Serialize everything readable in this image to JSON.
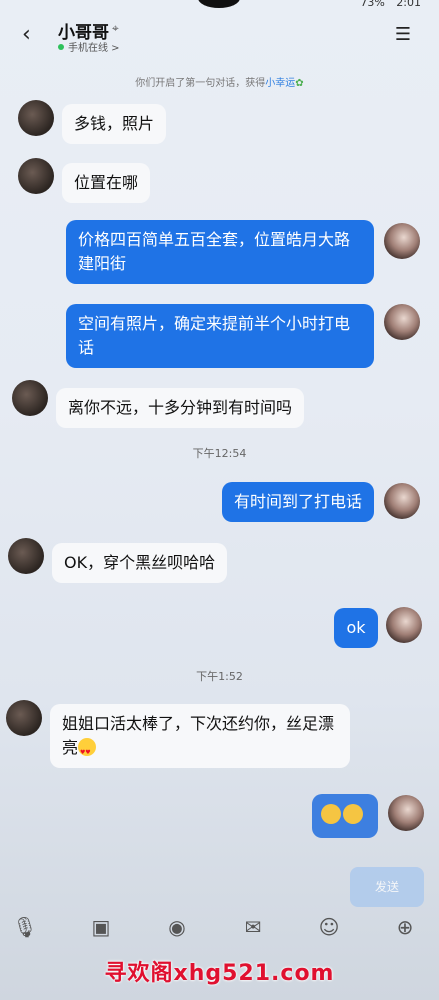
{
  "status_bar": {
    "battery": "73%",
    "time": "2:01"
  },
  "header": {
    "back_icon": "chevron-left-icon",
    "contact_name": "小哥哥",
    "location_icon": "location-pin-icon",
    "online_status": "手机在线 >",
    "menu_icon": "hamburger-menu-icon"
  },
  "system_message": {
    "prefix": "你们开启了第一句对话，获得",
    "highlight": "小幸运"
  },
  "messages": [
    {
      "side": "in",
      "text": "多钱，照片"
    },
    {
      "side": "in",
      "text": "位置在哪"
    },
    {
      "side": "out",
      "text": "价格四百简单五百全套，位置皓月大路建阳街"
    },
    {
      "side": "out",
      "text": "空间有照片，确定来提前半个小时打电话"
    },
    {
      "side": "in",
      "text": "离你不远，十多分钟到有时间吗"
    },
    {
      "side": "out",
      "text": "有时间到了打电话"
    },
    {
      "side": "in",
      "text": "OK，穿个黑丝呗哈哈"
    },
    {
      "side": "out",
      "text": "ok"
    },
    {
      "side": "in",
      "text": "姐姐口活太棒了，下次还约你，丝足漂亮"
    }
  ],
  "timestamps": [
    "下午12:54",
    "下午1:52"
  ],
  "input": {
    "send_label": "发送"
  },
  "toolbar": [
    "microphone-icon",
    "image-icon",
    "camera-icon",
    "red-packet-icon",
    "emoji-icon",
    "plus-icon"
  ],
  "watermark": "寻欢阁xhg521.com"
}
